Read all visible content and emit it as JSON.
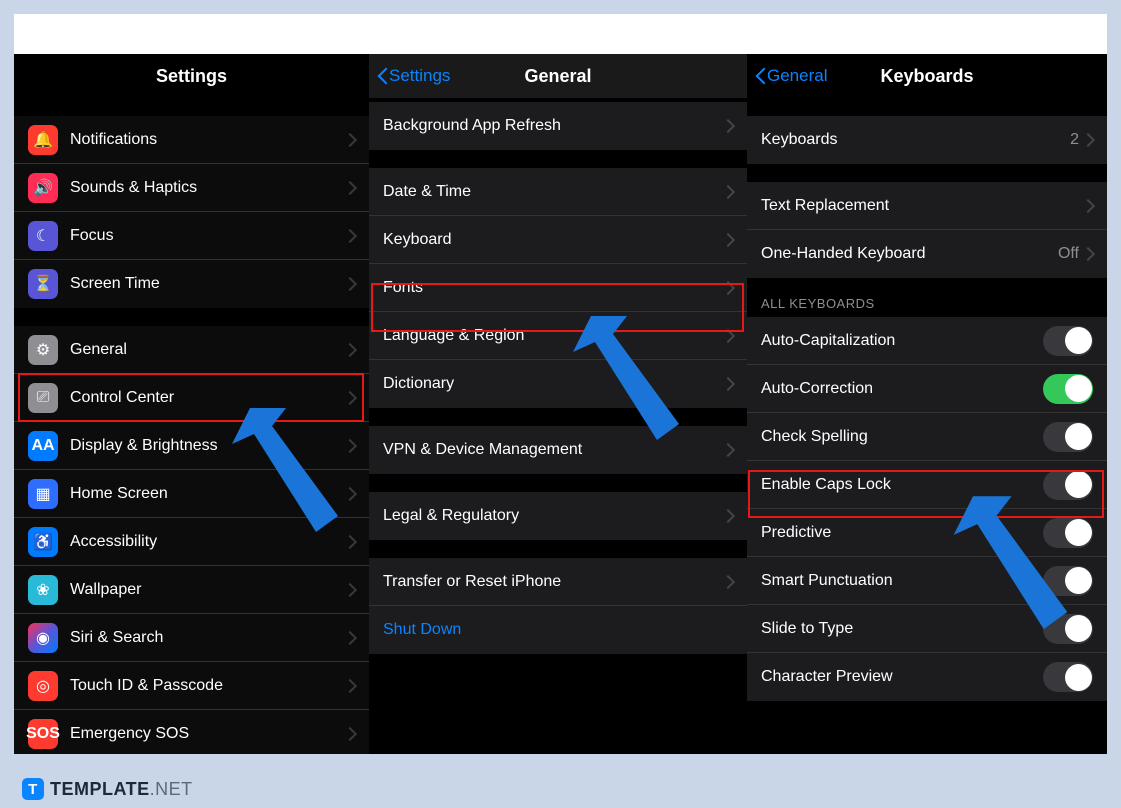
{
  "panel1": {
    "title": "Settings",
    "group1": [
      {
        "label": "Notifications",
        "icon": "bell",
        "iconClass": "ic-notif"
      },
      {
        "label": "Sounds & Haptics",
        "icon": "speaker",
        "iconClass": "ic-sound"
      },
      {
        "label": "Focus",
        "icon": "moon",
        "iconClass": "ic-focus"
      },
      {
        "label": "Screen Time",
        "icon": "hourglass",
        "iconClass": "ic-screentime"
      }
    ],
    "group2": [
      {
        "label": "General",
        "icon": "gear",
        "iconClass": "ic-general"
      },
      {
        "label": "Control Center",
        "icon": "switches",
        "iconClass": "ic-control"
      },
      {
        "label": "Display & Brightness",
        "icon": "AA",
        "iconClass": "ic-display"
      },
      {
        "label": "Home Screen",
        "icon": "grid",
        "iconClass": "ic-home"
      },
      {
        "label": "Accessibility",
        "icon": "person",
        "iconClass": "ic-access"
      },
      {
        "label": "Wallpaper",
        "icon": "flower",
        "iconClass": "ic-wallpaper"
      },
      {
        "label": "Siri & Search",
        "icon": "siri",
        "iconClass": "ic-siri"
      },
      {
        "label": "Touch ID & Passcode",
        "icon": "fingerprint",
        "iconClass": "ic-touchid"
      },
      {
        "label": "Emergency SOS",
        "icon": "SOS",
        "iconClass": "ic-sos"
      }
    ]
  },
  "panel2": {
    "back": "Settings",
    "title": "General",
    "group0": [
      {
        "label": "Background App Refresh"
      }
    ],
    "group1": [
      {
        "label": "Date & Time"
      },
      {
        "label": "Keyboard"
      },
      {
        "label": "Fonts"
      },
      {
        "label": "Language & Region"
      },
      {
        "label": "Dictionary"
      }
    ],
    "group2": [
      {
        "label": "VPN & Device Management"
      }
    ],
    "group3": [
      {
        "label": "Legal & Regulatory"
      }
    ],
    "group4": [
      {
        "label": "Transfer or Reset iPhone"
      },
      {
        "label": "Shut Down",
        "blue": true
      }
    ]
  },
  "panel3": {
    "back": "General",
    "title": "Keyboards",
    "group1": [
      {
        "label": "Keyboards",
        "value": "2"
      }
    ],
    "group2": [
      {
        "label": "Text Replacement"
      },
      {
        "label": "One-Handed Keyboard",
        "value": "Off"
      }
    ],
    "sectionHeader": "ALL KEYBOARDS",
    "toggles": [
      {
        "label": "Auto-Capitalization",
        "on": false,
        "knobRight": true
      },
      {
        "label": "Auto-Correction",
        "on": true
      },
      {
        "label": "Check Spelling",
        "on": false,
        "knobRight": true
      },
      {
        "label": "Enable Caps Lock",
        "on": false,
        "knobRight": true
      },
      {
        "label": "Predictive",
        "on": false,
        "knobRight": true
      },
      {
        "label": "Smart Punctuation",
        "on": false,
        "knobRight": true
      },
      {
        "label": "Slide to Type",
        "on": false,
        "knobRight": true
      },
      {
        "label": "Character Preview",
        "on": false,
        "knobRight": true
      }
    ]
  },
  "footer": {
    "brand_bold": "TEMPLATE",
    "brand_thin": ".NET"
  }
}
